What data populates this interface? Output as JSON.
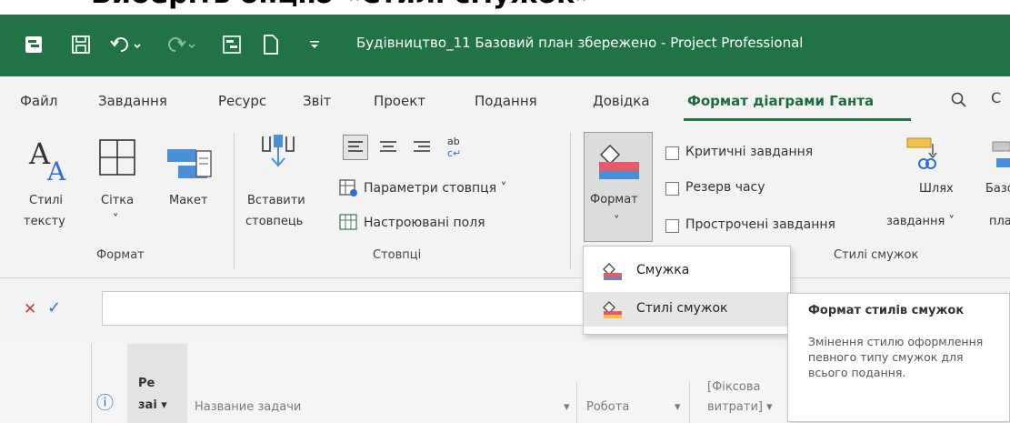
{
  "instruction_strip": {
    "text": "Виберіть опцію «Стилі смужок»"
  },
  "title_bar": {
    "title": "Будівництво_11 Базовий план збережено  -  Project Professional"
  },
  "menu": {
    "tabs": [
      "Файл",
      "Завдання",
      "Ресурс",
      "Звіт",
      "Проект",
      "Подання",
      "Довідка",
      "Формат діаграми Ганта"
    ],
    "active_tab": "Формат діаграми Ганта"
  },
  "ribbon": {
    "text_styles": {
      "line1": "Стилі",
      "line2": "тексту"
    },
    "grid": {
      "line1": "Сітка",
      "line2": "˅"
    },
    "layout": {
      "label": "Макет"
    },
    "group_format": "Формат",
    "insert_column": {
      "line1": "Вставити",
      "line2": "стовпець"
    },
    "column_settings": "Параметри стовпця ˅",
    "custom_fields": "Настроювані поля",
    "group_columns": "Стовпці",
    "format_button": {
      "label": "Формат",
      "chevron": "˅"
    },
    "checkboxes": {
      "critical_tasks": "Критичні завдання",
      "slack": "Резерв часу",
      "late_tasks": "Прострочені завдання"
    },
    "task_path": {
      "line1": "Шлях",
      "line2": "завдання ˅"
    },
    "baseline_partial": {
      "line1": "Базо",
      "line2": "пла"
    },
    "group_bar_styles": "Стилі смужок"
  },
  "dropdown": {
    "items": [
      {
        "label": "Смужка",
        "icon": "bar-icon"
      },
      {
        "label": "Стилі смужок",
        "icon": "bar-styles-icon",
        "hovered": true
      }
    ]
  },
  "tooltip": {
    "title": "Формат стилів смужок",
    "body": "Змінення стилю оформлення певного типу смужок для всього подання."
  },
  "formula_bar": {
    "cancel": "✕",
    "enter": "✓"
  },
  "columns": {
    "info": "ⓘ",
    "mode_line1": "Ре",
    "mode_line2": "заі ▾",
    "task_name": "Название задачи",
    "work": "Робота",
    "fixed_cost_line1": "[Фіксова",
    "fixed_cost_line2": "витрати] ▾"
  },
  "colors": {
    "title_bar": "#217346",
    "active_tab": "#1e6b41",
    "ribbon_bg": "#f3f3f3",
    "cancel_red": "#c23b3b",
    "enter_blue": "#2f6fd1"
  }
}
